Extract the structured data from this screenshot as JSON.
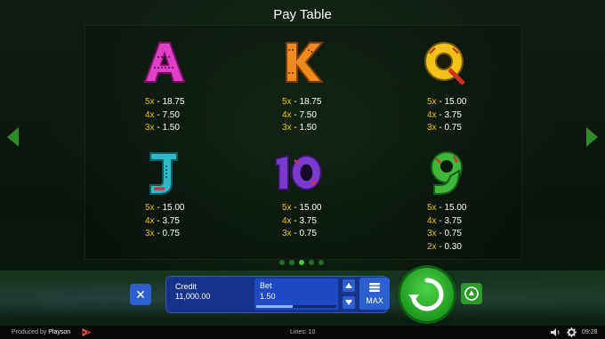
{
  "title": "Pay Table",
  "symbols": [
    {
      "name": "A",
      "color": "#e040c8",
      "pays": [
        {
          "mult": "5x",
          "val": "18.75"
        },
        {
          "mult": "4x",
          "val": "7.50"
        },
        {
          "mult": "3x",
          "val": "1.50"
        }
      ]
    },
    {
      "name": "K",
      "color": "#f08a1c",
      "pays": [
        {
          "mult": "5x",
          "val": "18.75"
        },
        {
          "mult": "4x",
          "val": "7.50"
        },
        {
          "mult": "3x",
          "val": "1.50"
        }
      ]
    },
    {
      "name": "Q",
      "color": "#f2c21a",
      "pays": [
        {
          "mult": "5x",
          "val": "15.00"
        },
        {
          "mult": "4x",
          "val": "3.75"
        },
        {
          "mult": "3x",
          "val": "0.75"
        }
      ]
    },
    {
      "name": "J",
      "color": "#2fb8c8",
      "pays": [
        {
          "mult": "5x",
          "val": "15.00"
        },
        {
          "mult": "4x",
          "val": "3.75"
        },
        {
          "mult": "3x",
          "val": "0.75"
        }
      ]
    },
    {
      "name": "10",
      "color": "#7a3ad0",
      "pays": [
        {
          "mult": "5x",
          "val": "15.00"
        },
        {
          "mult": "4x",
          "val": "3.75"
        },
        {
          "mult": "3x",
          "val": "0.75"
        }
      ]
    },
    {
      "name": "9",
      "color": "#3fb83a",
      "pays": [
        {
          "mult": "5x",
          "val": "15.00"
        },
        {
          "mult": "4x",
          "val": "3.75"
        },
        {
          "mult": "3x",
          "val": "0.75"
        },
        {
          "mult": "2x",
          "val": "0.30"
        }
      ]
    }
  ],
  "pagination": {
    "pages": 5,
    "active": 3
  },
  "console": {
    "close_icon": "close-icon",
    "credit_label": "Credit",
    "credit_value": "11,000.00",
    "bet_label": "Bet",
    "bet_value": "1.50",
    "bet_level": 0.45,
    "max_label": "MAX"
  },
  "footer": {
    "produced_prefix": "Produced by",
    "produced_brand": "Playson",
    "lines": "Lines: 10",
    "time": "09:28"
  },
  "colors": {
    "accent_green": "#2d9b2a",
    "multiplier_yellow": "#f2c200",
    "console_blue": "#1e48c4"
  }
}
